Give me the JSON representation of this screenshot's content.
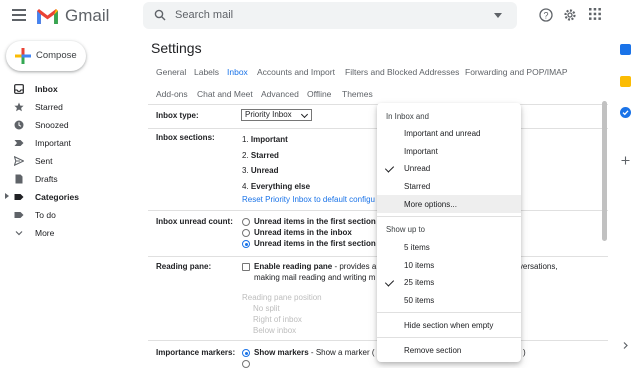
{
  "app": {
    "name": "Gmail"
  },
  "search": {
    "placeholder": "Search mail"
  },
  "sidebar": {
    "compose_label": "Compose",
    "items": [
      {
        "label": "Inbox",
        "icon": "inbox-icon",
        "bold": true
      },
      {
        "label": "Starred",
        "icon": "star-icon",
        "bold": false
      },
      {
        "label": "Snoozed",
        "icon": "clock-icon",
        "bold": false
      },
      {
        "label": "Important",
        "icon": "important-icon",
        "bold": false
      },
      {
        "label": "Sent",
        "icon": "send-icon",
        "bold": false
      },
      {
        "label": "Drafts",
        "icon": "draft-icon",
        "bold": false
      },
      {
        "label": "Categories",
        "icon": "label-icon",
        "bold": true
      },
      {
        "label": "To do",
        "icon": "label-icon",
        "bold": false
      },
      {
        "label": "More",
        "icon": "chevron-down-icon",
        "bold": false
      }
    ]
  },
  "settings": {
    "title": "Settings",
    "tabs_row1": [
      "General",
      "Labels",
      "Inbox",
      "Accounts and Import",
      "Filters and Blocked Addresses",
      "Forwarding and POP/IMAP"
    ],
    "tabs_row2": [
      "Add-ons",
      "Chat and Meet",
      "Advanced",
      "Offline",
      "Themes"
    ],
    "active_tab": "Inbox",
    "inbox_type": {
      "label": "Inbox type:",
      "value": "Priority Inbox"
    },
    "inbox_sections": {
      "label": "Inbox sections:",
      "sections": [
        {
          "num": "1.",
          "name": "Important"
        },
        {
          "num": "2.",
          "name": "Starred"
        },
        {
          "num": "3.",
          "name": "Unread"
        },
        {
          "num": "4.",
          "name": "Everything else"
        }
      ],
      "reset_link": "Reset Priority Inbox to default configu"
    },
    "unread_count": {
      "label": "Inbox unread count:",
      "options": [
        "Unread items in the first section",
        "Unread items in the inbox",
        "Unread items in the first section ar"
      ]
    },
    "reading_pane": {
      "label": "Reading pane:",
      "enable_bold": "Enable reading pane",
      "enable_rest": " - provides a w",
      "line2": "making mail reading and writing m",
      "right_fragment": "onversations,",
      "position_label": "Reading pane position",
      "positions": [
        "No split",
        "Right of inbox",
        "Below inbox"
      ]
    },
    "importance": {
      "label": "Importance markers:",
      "show_bold": "Show markers",
      "show_rest": " - Show a marker (",
      "right_fragment": ")"
    }
  },
  "dropdown": {
    "header1": "In Inbox and",
    "filter_items": [
      {
        "label": "Important and unread",
        "checked": false
      },
      {
        "label": "Important",
        "checked": false
      },
      {
        "label": "Unread",
        "checked": true
      },
      {
        "label": "Starred",
        "checked": false
      },
      {
        "label": "More options...",
        "checked": false
      }
    ],
    "header2": "Show up to",
    "count_items": [
      {
        "label": "5 items",
        "checked": false
      },
      {
        "label": "10 items",
        "checked": false
      },
      {
        "label": "25 items",
        "checked": true
      },
      {
        "label": "50 items",
        "checked": false
      }
    ],
    "hide_label": "Hide section when empty",
    "remove_label": "Remove section"
  },
  "colors": {
    "accent": "#1a73e8",
    "gmail_red": "#ea4335"
  }
}
